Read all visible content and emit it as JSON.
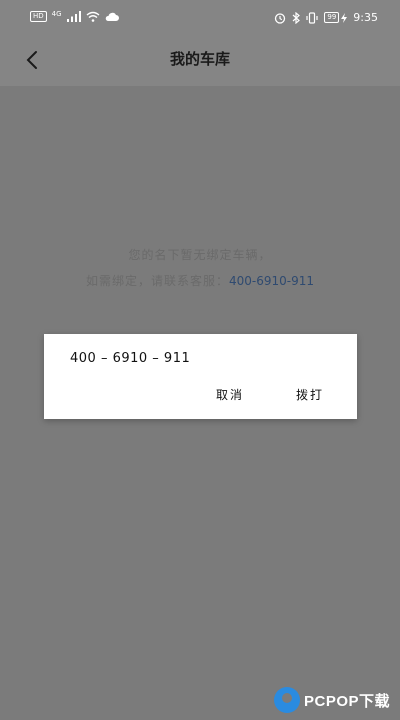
{
  "status_bar": {
    "network_badge": "HD",
    "signal_label": "4G",
    "battery_level": "99",
    "time": "9:35"
  },
  "header": {
    "title": "我的车库"
  },
  "empty_state": {
    "line1": "您的名下暂无绑定车辆，",
    "line2_prefix": "如需绑定，请联系客服：",
    "phone": "400-6910-911"
  },
  "dialog": {
    "message": "400 – 6910 – 911",
    "cancel_label": "取消",
    "dial_label": "拨打"
  },
  "watermark": {
    "text": "PCPOP下载"
  },
  "colors": {
    "overlay_bg": "#7b7b7b",
    "link_blue": "#2f4a70",
    "dialog_bg": "#ffffff",
    "watermark_blue": "#2a8be0"
  }
}
